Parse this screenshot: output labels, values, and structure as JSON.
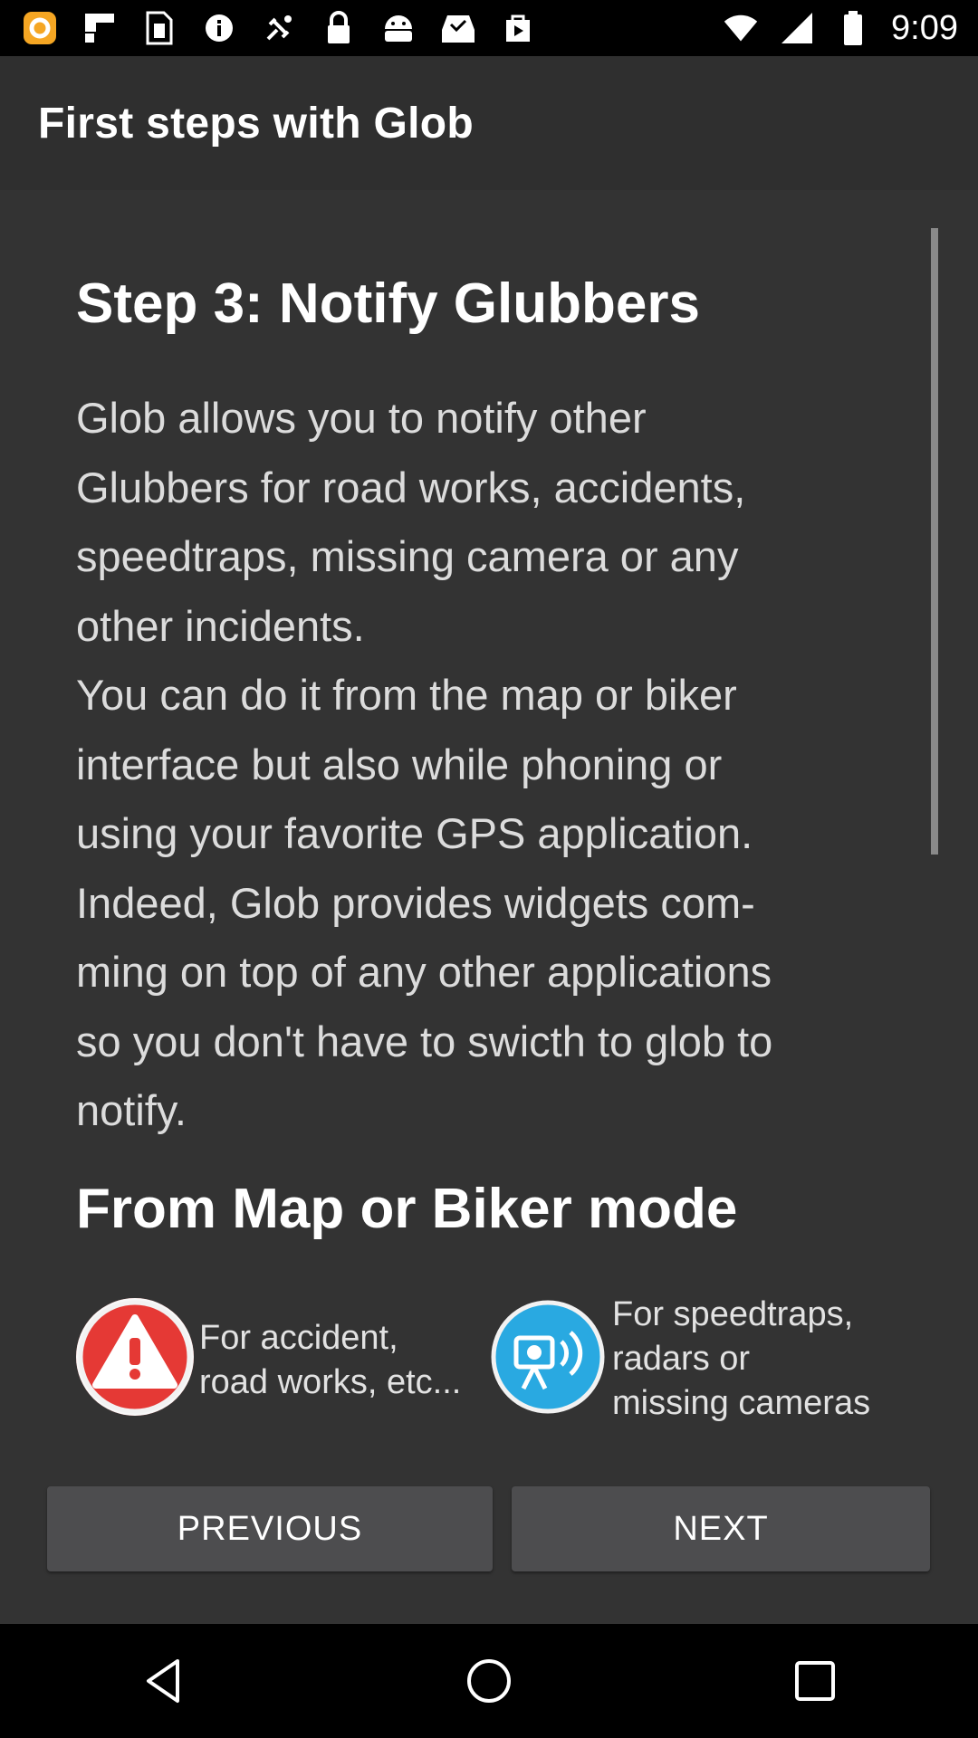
{
  "status_bar": {
    "time": "9:09",
    "icons": [
      "app-notification-icon",
      "flipboard-icon",
      "sim-card-icon",
      "info-icon",
      "gps-icon",
      "lock-icon",
      "android-icon",
      "inbox-check-icon",
      "play-store-icon"
    ]
  },
  "app_bar": {
    "title": "First steps with Glob"
  },
  "content": {
    "step_title": "Step 3: Notify Glubbers",
    "body": "Glob allows you to notify other\nGlubbers for road works, accidents,\nspeedtraps, missing camera or any\nother incidents.\nYou can do it from the map or biker\ninterface but also while phoning or\nusing your favorite GPS application.\nIndeed, Glob provides widgets com-\nming on top of any other applications\nso you don't have to swicth to glob to\nnotify.",
    "section_title": "From Map or Biker mode",
    "features": [
      {
        "icon": "warning-icon",
        "text": "For accident,\nroad works, etc...",
        "color": "#e53935"
      },
      {
        "icon": "speed-camera-icon",
        "text": "For speedtraps,\nradars or\nmissing cameras",
        "color": "#29a9e1"
      }
    ]
  },
  "buttons": {
    "previous": "PREVIOUS",
    "next": "NEXT"
  },
  "nav_bar": {
    "icons": [
      "back-icon",
      "home-icon",
      "recents-icon"
    ]
  }
}
